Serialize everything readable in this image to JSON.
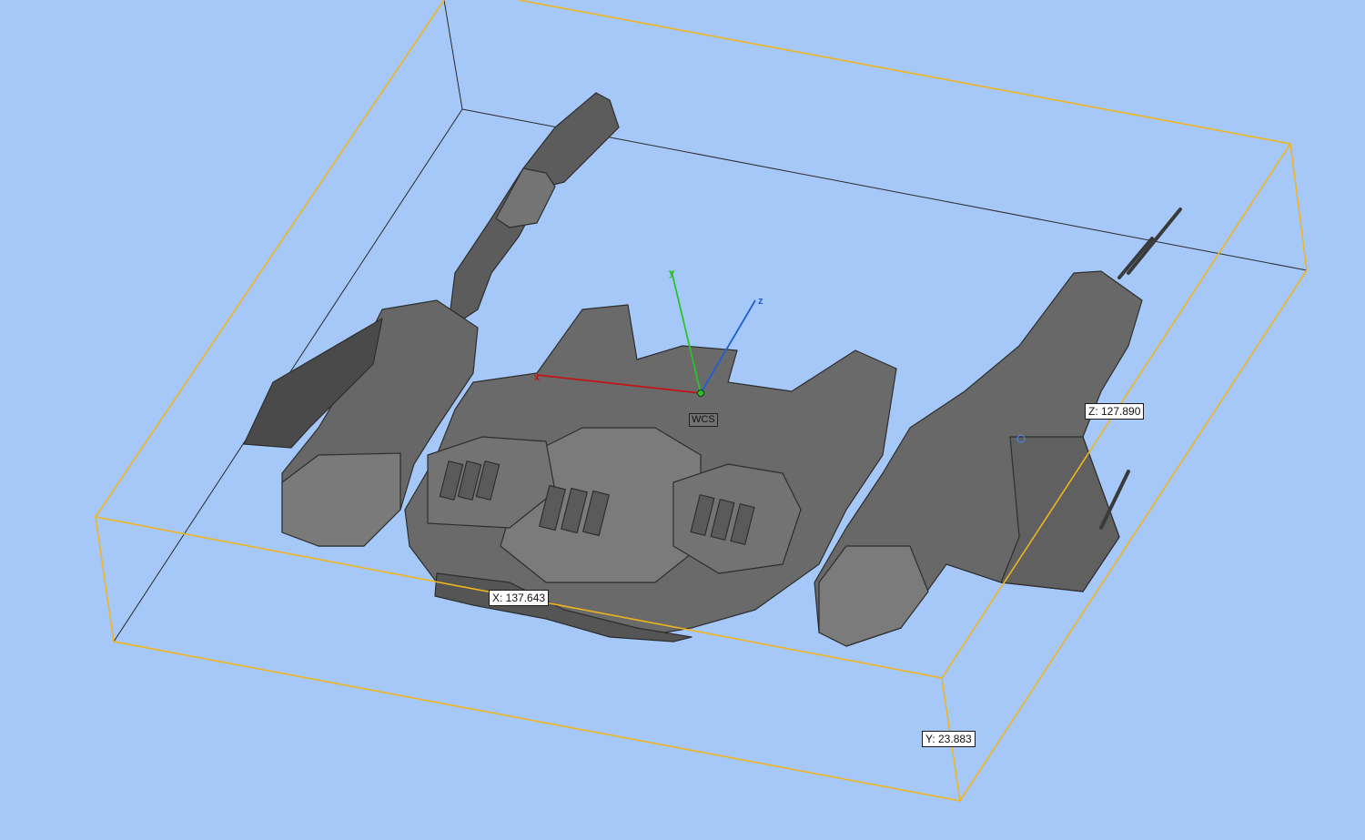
{
  "viewport": {
    "background_color": "#a5c8f9",
    "bounding_box_color": "#f0b51e",
    "model_color": "#6b6b6b"
  },
  "dimensions": {
    "x_label": "X: 137.643",
    "y_label": "Y: 23.883",
    "z_label": "Z: 127.890"
  },
  "coordinate_system": {
    "label": "WCS",
    "x_axis": {
      "letter": "x",
      "color": "#c41414"
    },
    "y_axis": {
      "letter": "y",
      "color": "#2cc22c"
    },
    "z_axis": {
      "letter": "z",
      "color": "#1f5fd1"
    }
  }
}
